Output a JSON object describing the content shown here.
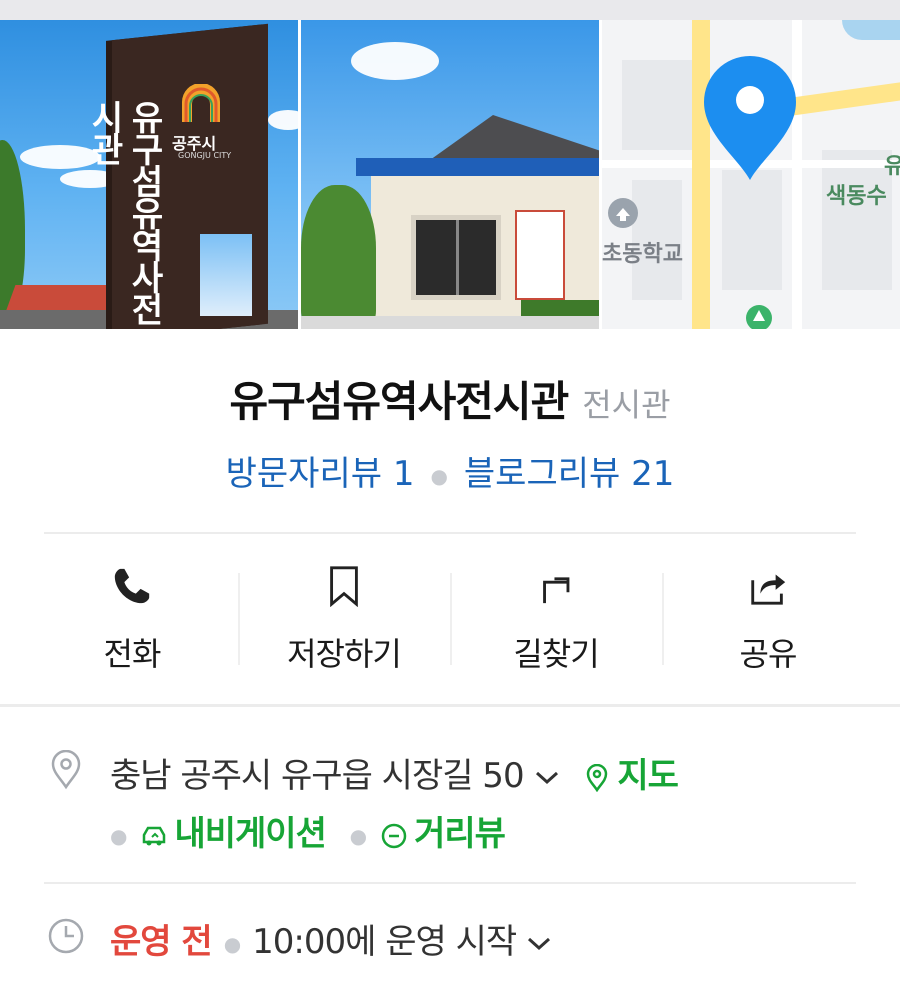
{
  "photos": [
    {
      "sign_text": "유구섬유역사전시관",
      "logo_text": "공주시",
      "logo_sub": "GONGJU CITY"
    },
    {},
    {
      "map_labels": [
        "유",
        "색동수",
        "초동학교"
      ]
    }
  ],
  "place": {
    "name": "유구섬유역사전시관",
    "category": "전시관"
  },
  "reviews": {
    "visitor_label": "방문자리뷰 1",
    "blog_label": "블로그리뷰 21"
  },
  "actions": [
    {
      "label": "전화",
      "icon": "phone-icon"
    },
    {
      "label": "저장하기",
      "icon": "bookmark-icon"
    },
    {
      "label": "길찾기",
      "icon": "directions-icon"
    },
    {
      "label": "공유",
      "icon": "share-icon"
    }
  ],
  "address": {
    "text": "충남 공주시 유구읍 시장길 50",
    "map_link": "지도",
    "navigation_link": "내비게이션",
    "streetview_link": "거리뷰"
  },
  "hours": {
    "status": "운영 전",
    "detail": "10:00에 운영 시작"
  },
  "colors": {
    "accent_blue": "#1a64b8",
    "link_green": "#17a536",
    "status_red": "#e2483d",
    "pin_blue": "#1c8ef0"
  }
}
